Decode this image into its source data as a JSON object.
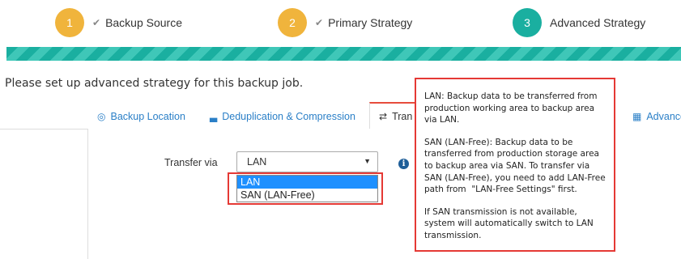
{
  "stepper": {
    "steps": [
      {
        "number": "1",
        "label": "Backup Source",
        "done": true,
        "color": "#f0b43c"
      },
      {
        "number": "2",
        "label": "Primary Strategy",
        "done": true,
        "color": "#f0b43c"
      },
      {
        "number": "3",
        "label": "Advanced Strategy",
        "done": false,
        "color": "#1aafa0"
      }
    ],
    "check_glyph": "✔"
  },
  "intro": "Please set up advanced strategy for this backup job.",
  "tabs": [
    {
      "icon": "location-pin-icon",
      "glyph": "◎",
      "label": "Backup Location"
    },
    {
      "icon": "disk-icon",
      "glyph": "▃",
      "label": "Deduplication & Compression"
    },
    {
      "icon": "transfer-arrows-icon",
      "glyph": "⇄",
      "label": "Tran"
    },
    {
      "icon": "grid-icon",
      "glyph": "▦",
      "label": "Advance"
    }
  ],
  "form": {
    "transfer_label": "Transfer via",
    "selected_value": "LAN",
    "caret": "▼",
    "options": [
      "LAN",
      "SAN (LAN-Free)"
    ]
  },
  "tooltip": {
    "info_glyph": "i",
    "paragraphs": [
      "LAN: Backup data to be transferred from production working area to backup area via LAN.",
      "SAN (LAN-Free): Backup data to be transferred from production storage area to backup area via SAN. To transfer via SAN (LAN-Free), you need to add LAN-Free path from  \"LAN-Free Settings\" first.",
      "If SAN transmission is not available, system will automatically switch to LAN transmission."
    ]
  },
  "colors": {
    "accent": "#1aafa0",
    "step_done": "#f0b43c",
    "highlight": "#e53935",
    "link": "#2a7fc7"
  }
}
